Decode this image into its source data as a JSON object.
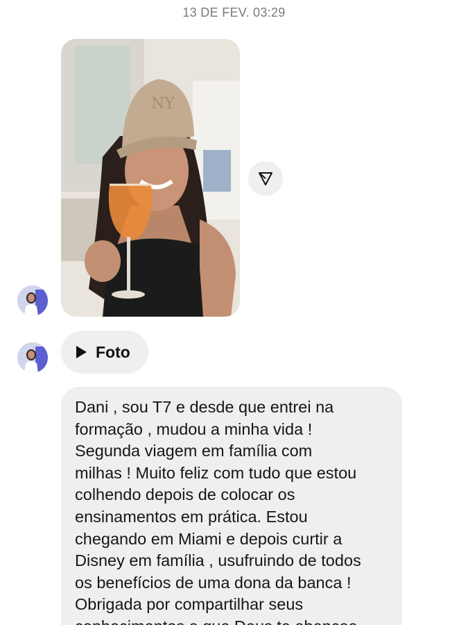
{
  "timestamp": "13 DE FEV. 03:29",
  "photo_message": {
    "icon": "share-icon"
  },
  "video_message": {
    "label": "Foto",
    "icon": "play-icon"
  },
  "text_message": {
    "text": "Dani , sou T7 e desde que entrei na\nformação , mudou a minha vida !\nSegunda viagem em família com\nmilhas ! Muito feliz com tudo que estou\ncolhendo depois de colocar os\nensinamentos em prática. Estou\nchegando em Miami e depois curtir a\nDisney em família , usufruindo de todos\nos benefícios de uma dona da banca !\nObrigada por compartilhar seus\nconhecimentos e que Deus te abençoe"
  }
}
